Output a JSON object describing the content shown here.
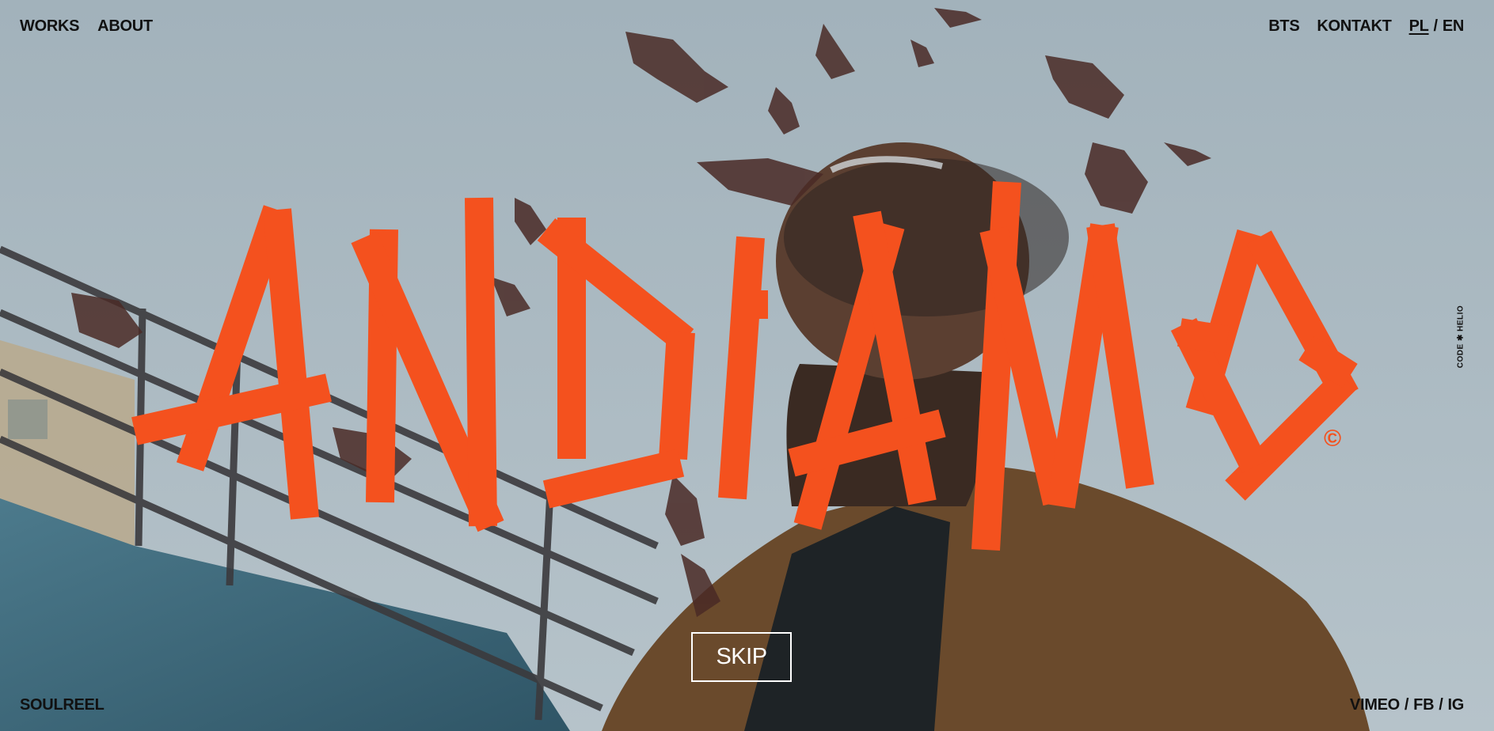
{
  "nav": {
    "works": "WORKS",
    "about": "ABOUT",
    "bts": "BTS",
    "kontakt": "KONTAKT",
    "lang_pl": "PL",
    "lang_separator": "/",
    "lang_en": "EN"
  },
  "footer": {
    "soulreel": "SOULREEL",
    "vimeo": "VIMEO",
    "fb": "FB",
    "ig": "IG",
    "separator": "/"
  },
  "hero": {
    "logo_text": "ANDIAMO",
    "copyright_symbol": "©",
    "skip_label": "SKIP"
  },
  "credit": {
    "label": "CODE ✱ HELIO"
  },
  "colors": {
    "brand_orange": "#f4511e",
    "text": "#111111",
    "skip_border": "#ffffff"
  },
  "icons": {
    "background": "video-still-man-looking-up"
  }
}
